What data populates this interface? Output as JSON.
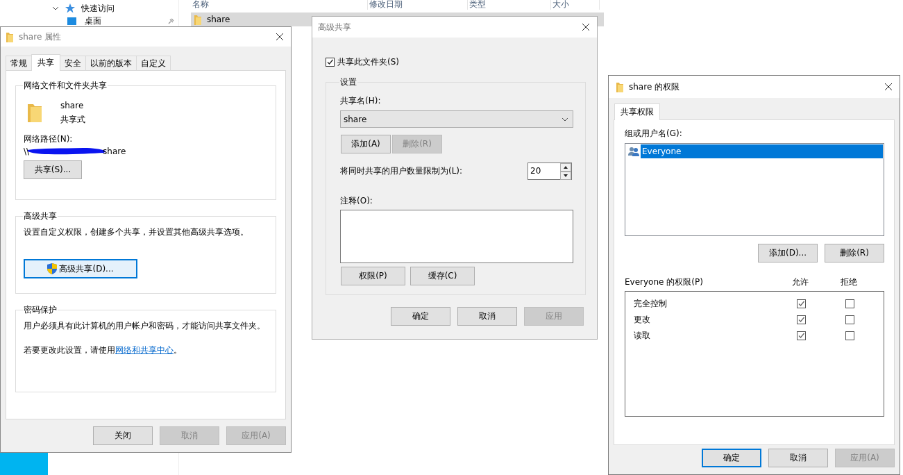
{
  "explorer": {
    "quick_access": {
      "label": "快速访问",
      "expanded": true,
      "children": [
        {
          "label": "桌面"
        }
      ]
    },
    "columns": [
      "名称",
      "修改日期",
      "类型",
      "大小"
    ],
    "files": [
      {
        "name": "share",
        "selected": true
      }
    ]
  },
  "properties": {
    "title": "share 属性",
    "active": false,
    "tabs": [
      {
        "label": "常规",
        "selected": false
      },
      {
        "label": "共享",
        "selected": true
      },
      {
        "label": "安全",
        "selected": false
      },
      {
        "label": "以前的版本",
        "selected": false
      },
      {
        "label": "自定义",
        "selected": false
      }
    ],
    "network_group": {
      "title": "网络文件和文件夹共享",
      "folder_name": "share",
      "folder_status": "共享式",
      "path_label": "网络路径(N):",
      "path_start": "\\\\",
      "path_end": "share",
      "button": "共享(S)..."
    },
    "advanced_group": {
      "title": "高级共享",
      "description": "设置自定义权限，创建多个共享，并设置其他高级共享选项。",
      "button": {
        "label": "高级共享(D)...",
        "focused": true
      }
    },
    "password_group": {
      "title": "密码保护",
      "description": "用户必须具有此计算机的用户帐户和密码，才能访问共享文件夹。",
      "hint": "若要更改此设置，请使用",
      "link": "网络和共享中心",
      "hint_end": "。"
    },
    "buttons": [
      {
        "label": "关闭",
        "disabled": false
      },
      {
        "label": "取消",
        "disabled": true
      },
      {
        "label": "应用(A)",
        "disabled": true
      }
    ]
  },
  "advanced": {
    "title": "高级共享",
    "active": false,
    "share_checkbox": {
      "label": "共享此文件夹(S)",
      "checked": true
    },
    "settings_title": "设置",
    "share_name_label": "共享名(H):",
    "share_name": "share",
    "name_buttons": [
      {
        "label": "添加(A)",
        "disabled": false
      },
      {
        "label": "删除(R)",
        "disabled": true
      }
    ],
    "user_limit_label": "将同时共享的用户数量限制为(L):",
    "user_limit": "20",
    "comment_label": "注释(O):",
    "option_buttons": [
      {
        "label": "权限(P)",
        "disabled": false
      },
      {
        "label": "缓存(C)",
        "disabled": false
      }
    ],
    "buttons": [
      {
        "label": "确定",
        "disabled": false
      },
      {
        "label": "取消",
        "disabled": false
      },
      {
        "label": "应用",
        "disabled": true
      }
    ]
  },
  "permissions": {
    "title": "share 的权限",
    "active": true,
    "tabs": [
      {
        "label": "共享权限",
        "selected": true
      }
    ],
    "users_label": "组或用户名(G):",
    "users": [
      {
        "name": "Everyone",
        "selected": true
      }
    ],
    "user_buttons": [
      {
        "label": "添加(D)...",
        "disabled": false
      },
      {
        "label": "删除(R)",
        "disabled": false
      }
    ],
    "perm_label": "Everyone 的权限(P)",
    "allow_header": "允许",
    "deny_header": "拒绝",
    "perms": [
      {
        "name": "完全控制",
        "allow": true,
        "deny": false
      },
      {
        "name": "更改",
        "allow": true,
        "deny": false
      },
      {
        "name": "读取",
        "allow": true,
        "deny": false
      }
    ],
    "buttons": [
      {
        "label": "确定",
        "disabled": false,
        "focused": true
      },
      {
        "label": "取消",
        "disabled": false,
        "focused": false
      },
      {
        "label": "应用(A)",
        "disabled": true,
        "focused": false
      }
    ]
  }
}
